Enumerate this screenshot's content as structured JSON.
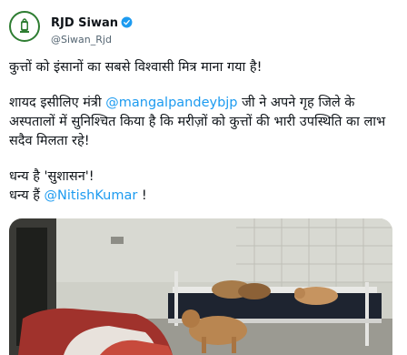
{
  "account": {
    "display_name": "RJD Siwan",
    "handle": "@Siwan_Rjd",
    "verified": true,
    "avatar_icon": "rjd-lantern-logo-icon"
  },
  "tweet": {
    "line1": "कुत्तों को इंसानों का सबसे विश्वासी मित्र माना गया है!",
    "para2_before": "शायद इसीलिए मंत्री ",
    "para2_mention": "@mangalpandeybjp",
    "para2_after": " जी ने अपने गृह जिले के अस्पतालों में सुनिश्चित किया है कि मरीज़ों को कुत्तों की भारी उपस्थिति का लाभ सदैव मिलता रहे!",
    "line4": "धन्य है 'सुशासन'!",
    "line5_before": "धन्य हैं ",
    "line5_mention": "@NitishKumar",
    "line5_after": " !"
  },
  "media": {
    "alt_icon": "hospital-ward-dogs-photo"
  },
  "colors": {
    "text": "#0f1419",
    "secondary": "#536471",
    "link": "#1d9bf0",
    "verified": "#1d9bf0",
    "avatar_border": "#2e7d32"
  }
}
